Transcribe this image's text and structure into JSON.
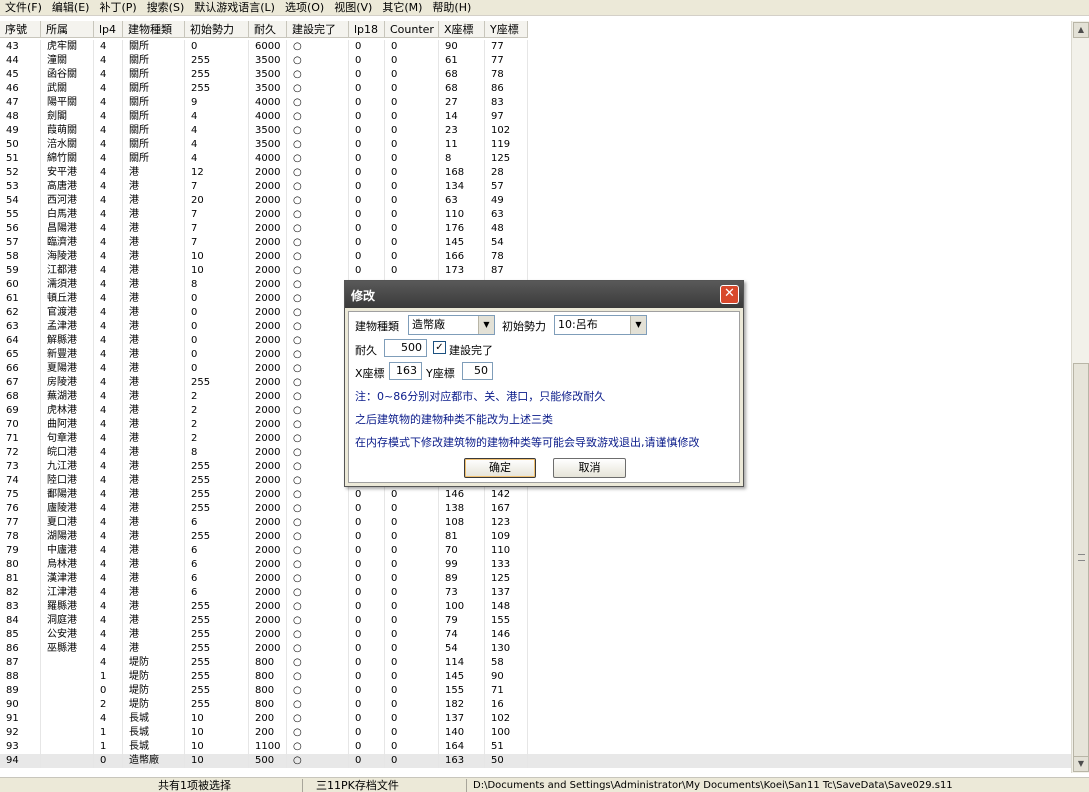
{
  "menu": [
    "文件(F)",
    "编辑(E)",
    "补丁(P)",
    "搜索(S)",
    "默认游戏语言(L)",
    "选项(O)",
    "视图(V)",
    "其它(M)",
    "帮助(H)"
  ],
  "columns": [
    "序號",
    "所属",
    "lp4",
    "建物種類",
    "初始勢力",
    "耐久",
    "建設完了",
    "lp18",
    "Counter",
    "X座標",
    "Y座標"
  ],
  "rows": [
    [
      "43",
      "虎牢關",
      "4",
      "關所",
      "0",
      "6000",
      "○",
      "0",
      "0",
      "90",
      "77"
    ],
    [
      "44",
      "潼關",
      "4",
      "關所",
      "255",
      "3500",
      "○",
      "0",
      "0",
      "61",
      "77"
    ],
    [
      "45",
      "函谷關",
      "4",
      "關所",
      "255",
      "3500",
      "○",
      "0",
      "0",
      "68",
      "78"
    ],
    [
      "46",
      "武關",
      "4",
      "關所",
      "255",
      "3500",
      "○",
      "0",
      "0",
      "68",
      "86"
    ],
    [
      "47",
      "陽平關",
      "4",
      "關所",
      "9",
      "4000",
      "○",
      "0",
      "0",
      "27",
      "83"
    ],
    [
      "48",
      "劍閣",
      "4",
      "關所",
      "4",
      "4000",
      "○",
      "0",
      "0",
      "14",
      "97"
    ],
    [
      "49",
      "葭萌關",
      "4",
      "關所",
      "4",
      "3500",
      "○",
      "0",
      "0",
      "23",
      "102"
    ],
    [
      "50",
      "涪水關",
      "4",
      "關所",
      "4",
      "3500",
      "○",
      "0",
      "0",
      "11",
      "119"
    ],
    [
      "51",
      "綿竹關",
      "4",
      "關所",
      "4",
      "4000",
      "○",
      "0",
      "0",
      "8",
      "125"
    ],
    [
      "52",
      "安平港",
      "4",
      "港",
      "12",
      "2000",
      "○",
      "0",
      "0",
      "168",
      "28"
    ],
    [
      "53",
      "高唐港",
      "4",
      "港",
      "7",
      "2000",
      "○",
      "0",
      "0",
      "134",
      "57"
    ],
    [
      "54",
      "西河港",
      "4",
      "港",
      "20",
      "2000",
      "○",
      "0",
      "0",
      "63",
      "49"
    ],
    [
      "55",
      "白馬港",
      "4",
      "港",
      "7",
      "2000",
      "○",
      "0",
      "0",
      "110",
      "63"
    ],
    [
      "56",
      "昌陽港",
      "4",
      "港",
      "7",
      "2000",
      "○",
      "0",
      "0",
      "176",
      "48"
    ],
    [
      "57",
      "臨濟港",
      "4",
      "港",
      "7",
      "2000",
      "○",
      "0",
      "0",
      "145",
      "54"
    ],
    [
      "58",
      "海陵港",
      "4",
      "港",
      "10",
      "2000",
      "○",
      "0",
      "0",
      "166",
      "78"
    ],
    [
      "59",
      "江都港",
      "4",
      "港",
      "10",
      "2000",
      "○",
      "0",
      "0",
      "173",
      "87"
    ],
    [
      "60",
      "濡須港",
      "4",
      "港",
      "8",
      "2000",
      "○",
      "",
      "",
      "",
      ""
    ],
    [
      "61",
      "頓丘港",
      "4",
      "港",
      "0",
      "2000",
      "○",
      "",
      "",
      "",
      ""
    ],
    [
      "62",
      "官渡港",
      "4",
      "港",
      "0",
      "2000",
      "○",
      "",
      "",
      "",
      ""
    ],
    [
      "63",
      "孟津港",
      "4",
      "港",
      "0",
      "2000",
      "○",
      "",
      "",
      "",
      ""
    ],
    [
      "64",
      "解縣港",
      "4",
      "港",
      "0",
      "2000",
      "○",
      "",
      "",
      "",
      ""
    ],
    [
      "65",
      "新豐港",
      "4",
      "港",
      "0",
      "2000",
      "○",
      "",
      "",
      "",
      ""
    ],
    [
      "66",
      "夏陽港",
      "4",
      "港",
      "0",
      "2000",
      "○",
      "",
      "",
      "",
      ""
    ],
    [
      "67",
      "房陵港",
      "4",
      "港",
      "255",
      "2000",
      "○",
      "",
      "",
      "",
      ""
    ],
    [
      "68",
      "蕪湖港",
      "4",
      "港",
      "2",
      "2000",
      "○",
      "",
      "",
      "",
      ""
    ],
    [
      "69",
      "虎林港",
      "4",
      "港",
      "2",
      "2000",
      "○",
      "",
      "",
      "",
      ""
    ],
    [
      "70",
      "曲阿港",
      "4",
      "港",
      "2",
      "2000",
      "○",
      "",
      "",
      "",
      ""
    ],
    [
      "71",
      "句章港",
      "4",
      "港",
      "2",
      "2000",
      "○",
      "",
      "",
      "",
      ""
    ],
    [
      "72",
      "皖口港",
      "4",
      "港",
      "8",
      "2000",
      "○",
      "",
      "",
      "",
      ""
    ],
    [
      "73",
      "九江港",
      "4",
      "港",
      "255",
      "2000",
      "○",
      "",
      "",
      "",
      ""
    ],
    [
      "74",
      "陸口港",
      "4",
      "港",
      "255",
      "2000",
      "○",
      "",
      "",
      "",
      ""
    ],
    [
      "75",
      "鄱陽港",
      "4",
      "港",
      "255",
      "2000",
      "○",
      "0",
      "0",
      "146",
      "142"
    ],
    [
      "76",
      "廬陵港",
      "4",
      "港",
      "255",
      "2000",
      "○",
      "0",
      "0",
      "138",
      "167"
    ],
    [
      "77",
      "夏口港",
      "4",
      "港",
      "6",
      "2000",
      "○",
      "0",
      "0",
      "108",
      "123"
    ],
    [
      "78",
      "湖陽港",
      "4",
      "港",
      "255",
      "2000",
      "○",
      "0",
      "0",
      "81",
      "109"
    ],
    [
      "79",
      "中廬港",
      "4",
      "港",
      "6",
      "2000",
      "○",
      "0",
      "0",
      "70",
      "110"
    ],
    [
      "80",
      "烏林港",
      "4",
      "港",
      "6",
      "2000",
      "○",
      "0",
      "0",
      "99",
      "133"
    ],
    [
      "81",
      "漢津港",
      "4",
      "港",
      "6",
      "2000",
      "○",
      "0",
      "0",
      "89",
      "125"
    ],
    [
      "82",
      "江津港",
      "4",
      "港",
      "6",
      "2000",
      "○",
      "0",
      "0",
      "73",
      "137"
    ],
    [
      "83",
      "羅縣港",
      "4",
      "港",
      "255",
      "2000",
      "○",
      "0",
      "0",
      "100",
      "148"
    ],
    [
      "84",
      "洞庭港",
      "4",
      "港",
      "255",
      "2000",
      "○",
      "0",
      "0",
      "79",
      "155"
    ],
    [
      "85",
      "公安港",
      "4",
      "港",
      "255",
      "2000",
      "○",
      "0",
      "0",
      "74",
      "146"
    ],
    [
      "86",
      "巫縣港",
      "4",
      "港",
      "255",
      "2000",
      "○",
      "0",
      "0",
      "54",
      "130"
    ],
    [
      "87",
      "",
      "4",
      "堤防",
      "255",
      "800",
      "○",
      "0",
      "0",
      "114",
      "58"
    ],
    [
      "88",
      "",
      "1",
      "堤防",
      "255",
      "800",
      "○",
      "0",
      "0",
      "145",
      "90"
    ],
    [
      "89",
      "",
      "0",
      "堤防",
      "255",
      "800",
      "○",
      "0",
      "0",
      "155",
      "71"
    ],
    [
      "90",
      "",
      "2",
      "堤防",
      "255",
      "800",
      "○",
      "0",
      "0",
      "182",
      "16"
    ],
    [
      "91",
      "",
      "4",
      "長城",
      "10",
      "200",
      "○",
      "0",
      "0",
      "137",
      "102"
    ],
    [
      "92",
      "",
      "1",
      "長城",
      "10",
      "200",
      "○",
      "0",
      "0",
      "140",
      "100"
    ],
    [
      "93",
      "",
      "1",
      "長城",
      "10",
      "1100",
      "○",
      "0",
      "0",
      "164",
      "51"
    ],
    [
      "94",
      "",
      "0",
      "造幣廠",
      "10",
      "500",
      "○",
      "0",
      "0",
      "163",
      "50"
    ]
  ],
  "status": {
    "selection": "共有1项被选择",
    "file_type": "三11PK存档文件",
    "path": "D:\\Documents and Settings\\Administrator\\My Documents\\Koei\\San11 Tc\\SaveData\\Save029.s11"
  },
  "dialog": {
    "title": "修改",
    "close": "✕",
    "building_type_label": "建物種類",
    "building_type_value": "造幣廠",
    "initial_force_label": "初始勢力",
    "initial_force_value": "10:呂布",
    "durability_label": "耐久",
    "durability_value": "500",
    "completed_label": "建設完了",
    "completed_mark": "✓",
    "x_label": "X座標",
    "x_value": "163",
    "y_label": "Y座標",
    "y_value": "50",
    "note1": "注：0~86分别对应都市、关、港口，只能修改耐久",
    "note2": "之后建筑物的建物种类不能改为上述三类",
    "note3": "在内存模式下修改建筑物的建物种类等可能会导致游戏退出,请谨慎修改",
    "ok": "确定",
    "cancel": "取消"
  },
  "icons": {
    "combo_arrow": "▼",
    "scroll_up": "▲",
    "scroll_down": "▼"
  }
}
